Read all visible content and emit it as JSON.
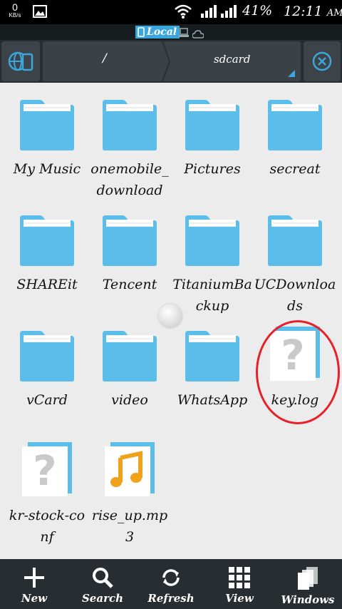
{
  "status_bar": {
    "net_speed_value": "0",
    "net_speed_unit": "KB/s",
    "battery": "41%",
    "time": "12:11",
    "ampm": "AM"
  },
  "location_bar": {
    "active": "Local"
  },
  "path_bar": {
    "crumbs": [
      "/",
      "sdcard"
    ]
  },
  "files": [
    {
      "name": "My Music",
      "type": "folder"
    },
    {
      "name": "onemobile_download",
      "type": "folder"
    },
    {
      "name": "Pictures",
      "type": "folder"
    },
    {
      "name": "secreat",
      "type": "folder"
    },
    {
      "name": "SHAREit",
      "type": "folder"
    },
    {
      "name": "Tencent",
      "type": "folder"
    },
    {
      "name": "TitaniumBackup",
      "type": "folder"
    },
    {
      "name": "UCDownloads",
      "type": "folder"
    },
    {
      "name": "vCard",
      "type": "folder"
    },
    {
      "name": "video",
      "type": "folder"
    },
    {
      "name": "WhatsApp",
      "type": "folder"
    },
    {
      "name": "key.log",
      "type": "unknown"
    },
    {
      "name": "kr-stock-conf",
      "type": "unknown"
    },
    {
      "name": "rise_up.mp3",
      "type": "audio"
    }
  ],
  "toolbar": {
    "new": "New",
    "search": "Search",
    "refresh": "Refresh",
    "view": "View",
    "windows": "Windows"
  },
  "colors": {
    "accent": "#3aa6db",
    "folder": "#5bbdea",
    "highlight": "#e8202a",
    "toolbar": "#272d31"
  }
}
